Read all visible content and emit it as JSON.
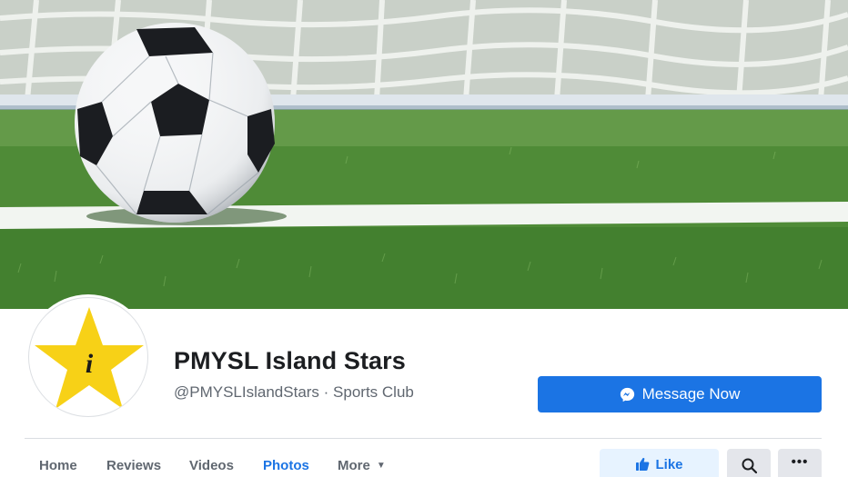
{
  "page": {
    "name": "PMYSL Island Stars",
    "handle": "@PMYSLIslandStars · Sports Club",
    "profile_letter": "i"
  },
  "actions": {
    "message_label": "Message Now",
    "like_label": "Like",
    "more_label": "•••"
  },
  "tabs": [
    {
      "label": "Home",
      "active": false
    },
    {
      "label": "Reviews",
      "active": false
    },
    {
      "label": "Videos",
      "active": false
    },
    {
      "label": "Photos",
      "active": true
    },
    {
      "label": "More",
      "active": false
    }
  ],
  "icons": {
    "message": "messenger-icon",
    "like": "thumbs-up-icon",
    "search": "search-icon",
    "more": "more-options-icon",
    "tab_more": "caret-down-icon"
  },
  "colors": {
    "brand_blue": "#1b74e4",
    "like_bg": "#e7f3ff",
    "star_yellow": "#f7d117",
    "text_primary": "#1c1e21",
    "text_secondary": "#606770"
  }
}
